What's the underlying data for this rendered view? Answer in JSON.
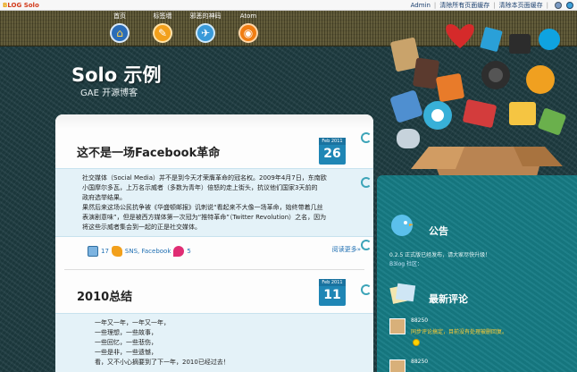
{
  "topbar": {
    "logo_b": "B",
    "logo_rest": "LOG Solo",
    "admin": "Admin",
    "clear_all_cache": "清除所有页面缓存",
    "clear_page_cache": "清除本页面缓存",
    "separator": "|",
    "icons": [
      "gear-icon",
      "globe-icon"
    ]
  },
  "nav": {
    "items": [
      {
        "label": "首页",
        "icon": "home-icon"
      },
      {
        "label": "标签墙",
        "icon": "tags-icon"
      },
      {
        "label": "邪恶的神码",
        "icon": "links-icon"
      },
      {
        "label": "Atom",
        "icon": "atom-feed-icon"
      }
    ]
  },
  "blog": {
    "title": "Solo 示例",
    "subtitle": "GAE 开源博客"
  },
  "posts": [
    {
      "title": "这不是一场Facebook革命",
      "month": "Feb 2011",
      "day": "26",
      "body": [
        "社交媒体（Social Media）并不是到今天才荣膺革命的冠名权。2009年4月7日，东南欧",
        "小国摩尔多瓦，上万名示威者（多数为青年）倍怒的走上街头，抗议他们国家3天前的",
        "政府选举结果。",
        "果然后来这场公民抗争被《华盛顿邮报》讥刺说“看起来不大像一场革命，始终带着几丝",
        "表演剧意味”，但是被西方媒体第一次冠为“推特革命”（Twitter Revolution）之名，因为",
        "将这些示威者集会到一起的正是社交媒体。"
      ],
      "meta": {
        "view_count": "17",
        "tags": "SNS, Facebook",
        "comment_count": "5",
        "read_more": "阅读更多»"
      }
    },
    {
      "title": "2010总结",
      "month": "Feb 2011",
      "day": "11",
      "body": [
        "一年又一年，一年又一年，",
        "一些理想，一些故事，",
        "一些回忆，一些悲伤，",
        "一些是非，一些遗憾，",
        "看，又不小心摘要到了下一年，2010已经过去！"
      ]
    }
  ],
  "sidebar": {
    "notice_heading": "公告",
    "notice_lines": [
      "0.2.5 正式版已经发布，请大家尽快升级！",
      "B3log 社区："
    ],
    "comments_heading": "最新评论",
    "comments": [
      {
        "name": "88250",
        "text": "同步评论搞定，目前没有处理被删回复。"
      },
      {
        "name": "88250",
        "text": ""
      }
    ]
  },
  "colors": {
    "background": "#1f3d42",
    "sidebar": "#167b84",
    "date_badge": "#1f86b5",
    "post_body": "#e4f2f8",
    "link": "#1f6fb2"
  }
}
